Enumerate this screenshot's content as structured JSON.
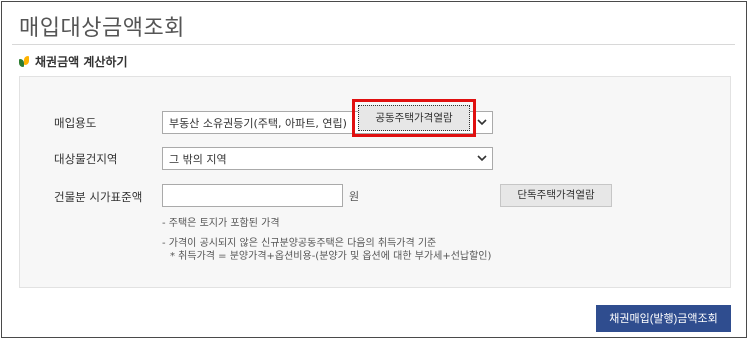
{
  "page": {
    "title": "매입대상금액조회"
  },
  "section": {
    "heading": "채권금액 계산하기",
    "icon": "leaf-icon"
  },
  "form": {
    "usage": {
      "label": "매입용도",
      "selected": "부동산 소유권등기(주택, 아파트, 연립)"
    },
    "region": {
      "label": "대상물건지역",
      "selected": "그 밖의 지역"
    },
    "price": {
      "label": "건물분 시가표준액",
      "value": "",
      "unit": "원"
    },
    "apartment_price_button": "공동주택가격열람",
    "detached_price_button": "단독주택가격열람"
  },
  "notes": {
    "line1": "- 주택은 토지가 포함된 가격",
    "line2": "- 가격이 공시되지 않은 신규분양공동주택은 다음의 취득가격 기준",
    "line3": "* 취득가격 = 분양가격+옵션비용-(분양가 및 옵션에 대한 부가세+선납할인)"
  },
  "actions": {
    "submit": "채권매입(발행)금액조회"
  },
  "colors": {
    "primary_button": "#2f4d8f",
    "focus_highlight": "#e01010"
  }
}
